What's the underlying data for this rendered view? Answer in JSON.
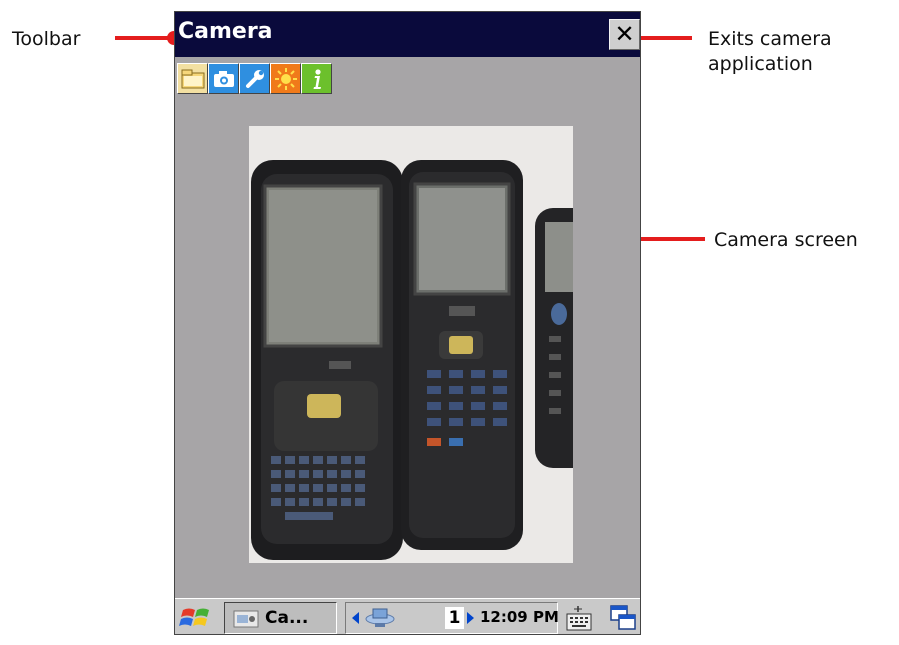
{
  "window": {
    "title": "Camera",
    "close_glyph": "✕"
  },
  "toolbar_icons": [
    "folder-icon",
    "camera-icon",
    "wrench-icon",
    "brightness-icon",
    "info-icon"
  ],
  "callouts": {
    "toolbar": "Toolbar",
    "exit_line1": "Exits camera",
    "exit_line2": "application",
    "camera_screen": "Camera screen"
  },
  "taskbar": {
    "app_label": "Ca...",
    "desktop_number": "1",
    "clock": "12:09 PM"
  },
  "colors": {
    "titlebar": "#0a0a3c",
    "screen_bg": "#a7a5a7",
    "callout_line": "#e41d1d",
    "taskbar": "#c9c9c9"
  }
}
